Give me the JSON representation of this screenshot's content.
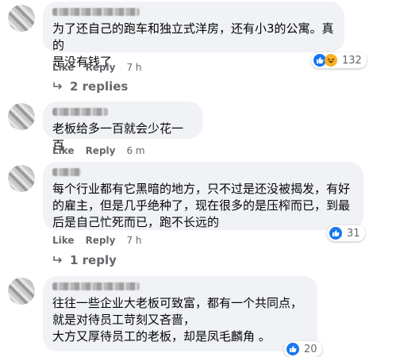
{
  "comments": [
    {
      "text": "为了还自己的跑车和独立式洋房，还有小3的公寓。真的\n是没有钱了",
      "like": "Like",
      "reply": "Reply",
      "time": "7 h",
      "reaction_count": "132",
      "reaction_icons": [
        "like-icon",
        "haha-icon"
      ],
      "replies_label": "2 replies"
    },
    {
      "text": "老板给多一百就会少花一百",
      "like": "Like",
      "reply": "Reply",
      "time": "6 m"
    },
    {
      "text": "每个行业都有它黑暗的地方，只不过是还没被揭发，有好\n的雇主，但是几乎绝种了，现在很多的是压榨而已，到最\n后是自己忙死而已，跑不长远的",
      "like": "Like",
      "reply": "Reply",
      "time": "7 h",
      "reaction_count": "31",
      "reaction_icons": [
        "like-icon"
      ],
      "replies_label": "1 reply"
    },
    {
      "text": "往往一些企业大老板可致富，都有一个共同点，\n就是对待员工苛刻又吝啬，\n大方又厚待员工的老板，却是凤毛麟角 。",
      "reaction_count": "20",
      "reaction_icons": [
        "like-icon"
      ]
    }
  ],
  "colors": {
    "bubble": "#f0f2f5",
    "secondary_text": "#65676b",
    "like_blue": "#1877f2",
    "haha_yellow": "#f7b125"
  }
}
